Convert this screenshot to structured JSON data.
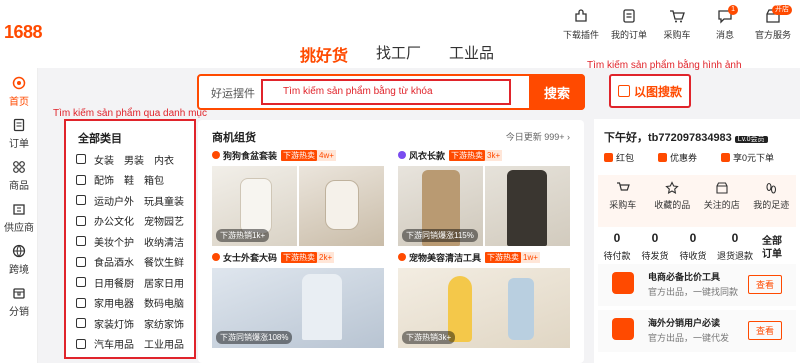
{
  "brand": {
    "logo": "1688"
  },
  "header_icons": [
    {
      "label": "下载插件",
      "icon": "plugin-icon"
    },
    {
      "label": "我的订单",
      "icon": "orders-icon"
    },
    {
      "label": "采购车",
      "icon": "cart-icon"
    },
    {
      "label": "消息",
      "icon": "message-icon",
      "badge": "1"
    },
    {
      "label": "官方服务",
      "icon": "service-icon",
      "badge": "开店"
    }
  ],
  "tabs": [
    "挑好货",
    "找工厂",
    "工业品"
  ],
  "left_nav": [
    "首页",
    "订单",
    "商品",
    "供应商",
    "跨境",
    "分销"
  ],
  "search": {
    "placeholder": "好运摆件",
    "annotation": "Tìm kiếm sản phẩm bằng từ khóa",
    "button": "搜索"
  },
  "image_search": {
    "label": "以图搜款",
    "annotation": "Tìm kiếm sản phẩm bằng hình ảnh"
  },
  "category_annotation": "Tìm kiếm sản phẩm qua danh mục",
  "categories": {
    "title": "全部类目",
    "rows": [
      [
        "女装",
        "男装",
        "内衣"
      ],
      [
        "配饰",
        "鞋",
        "箱包"
      ],
      [
        "运动户外",
        "玩具童装"
      ],
      [
        "办公文化",
        "宠物园艺"
      ],
      [
        "美妆个护",
        "收纳清洁"
      ],
      [
        "食品酒水",
        "餐饮生鲜"
      ],
      [
        "日用餐厨",
        "居家日用"
      ],
      [
        "家用电器",
        "数码电脑"
      ],
      [
        "家装灯饰",
        "家纺家饰"
      ],
      [
        "汽车用品",
        "工业用品"
      ]
    ]
  },
  "products": {
    "title": "商机组货",
    "update": "今日更新 999+",
    "cards": [
      {
        "name": "狗狗食盆套装",
        "hot": "下游热卖",
        "count": "4w+",
        "tag": "下游热销1k+"
      },
      {
        "name": "风衣长款",
        "hot": "下游热卖",
        "count": "3k+",
        "tag": "下游同销爆涨115%"
      },
      {
        "name": "女士外套大码",
        "hot": "下游热卖",
        "count": "2k+",
        "tag": "下游同销爆涨108%"
      },
      {
        "name": "宠物美容清洁工具",
        "hot": "下游热卖",
        "count": "1w+",
        "tag": "下游热销3k+"
      }
    ]
  },
  "account": {
    "greeting": "下午好，tb772097834983",
    "level": "Lv.0会员",
    "perks": [
      "红包",
      "优惠券",
      "享0元下单"
    ],
    "quick": [
      "采购车",
      "收藏的品",
      "关注的店",
      "我的足迹"
    ],
    "orders": [
      {
        "label": "待付款",
        "value": "0"
      },
      {
        "label": "待发货",
        "value": "0"
      },
      {
        "label": "待收货",
        "value": "0"
      },
      {
        "label": "退货退款",
        "value": "0"
      }
    ],
    "all_orders": "全部订单",
    "services": [
      {
        "title": "电商必备比价工具",
        "subtitle": "官方出品，一键找同款",
        "button": "查看"
      },
      {
        "title": "海外分销用户必读",
        "subtitle": "官方出品，一键代发",
        "button": "查看"
      }
    ]
  },
  "colors": {
    "accent": "#ff4a00",
    "annotation": "#e0242b"
  }
}
